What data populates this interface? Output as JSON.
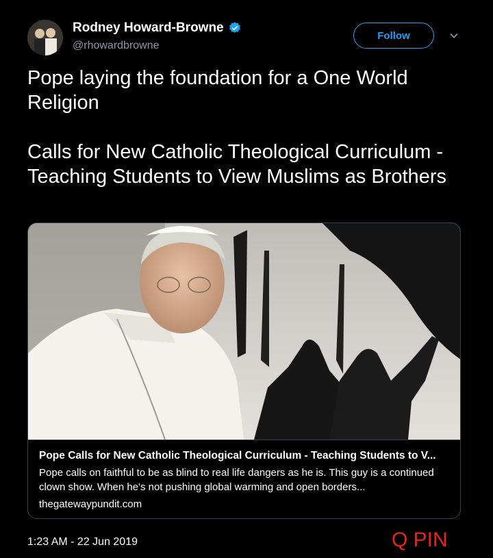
{
  "user": {
    "display_name": "Rodney Howard-Browne",
    "handle": "@rhowardbrowne",
    "verified": true
  },
  "actions": {
    "follow_label": "Follow",
    "more_icon": "chevron-down-icon"
  },
  "tweet": {
    "paragraphs": [
      "Pope laying the foundation for a One World Religion",
      "Calls for New Catholic Theological Curriculum - Teaching Students to View Muslims as Brothers"
    ],
    "timestamp": "1:23 AM - 22 Jun 2019"
  },
  "card": {
    "title": "Pope Calls for New Catholic Theological Curriculum - Teaching Students to V...",
    "description": "Pope calls on faithful to be as blind to real life dangers as he is. This guy is a continued clown show. When he's not pushing global warming and open borders...",
    "domain": "thegatewaypundit.com"
  },
  "watermark": "Q PIN",
  "colors": {
    "background": "#000000",
    "accent": "#1da1f2",
    "secondary_text": "#8b98a5",
    "border": "#38444d",
    "watermark": "#e8241a"
  }
}
